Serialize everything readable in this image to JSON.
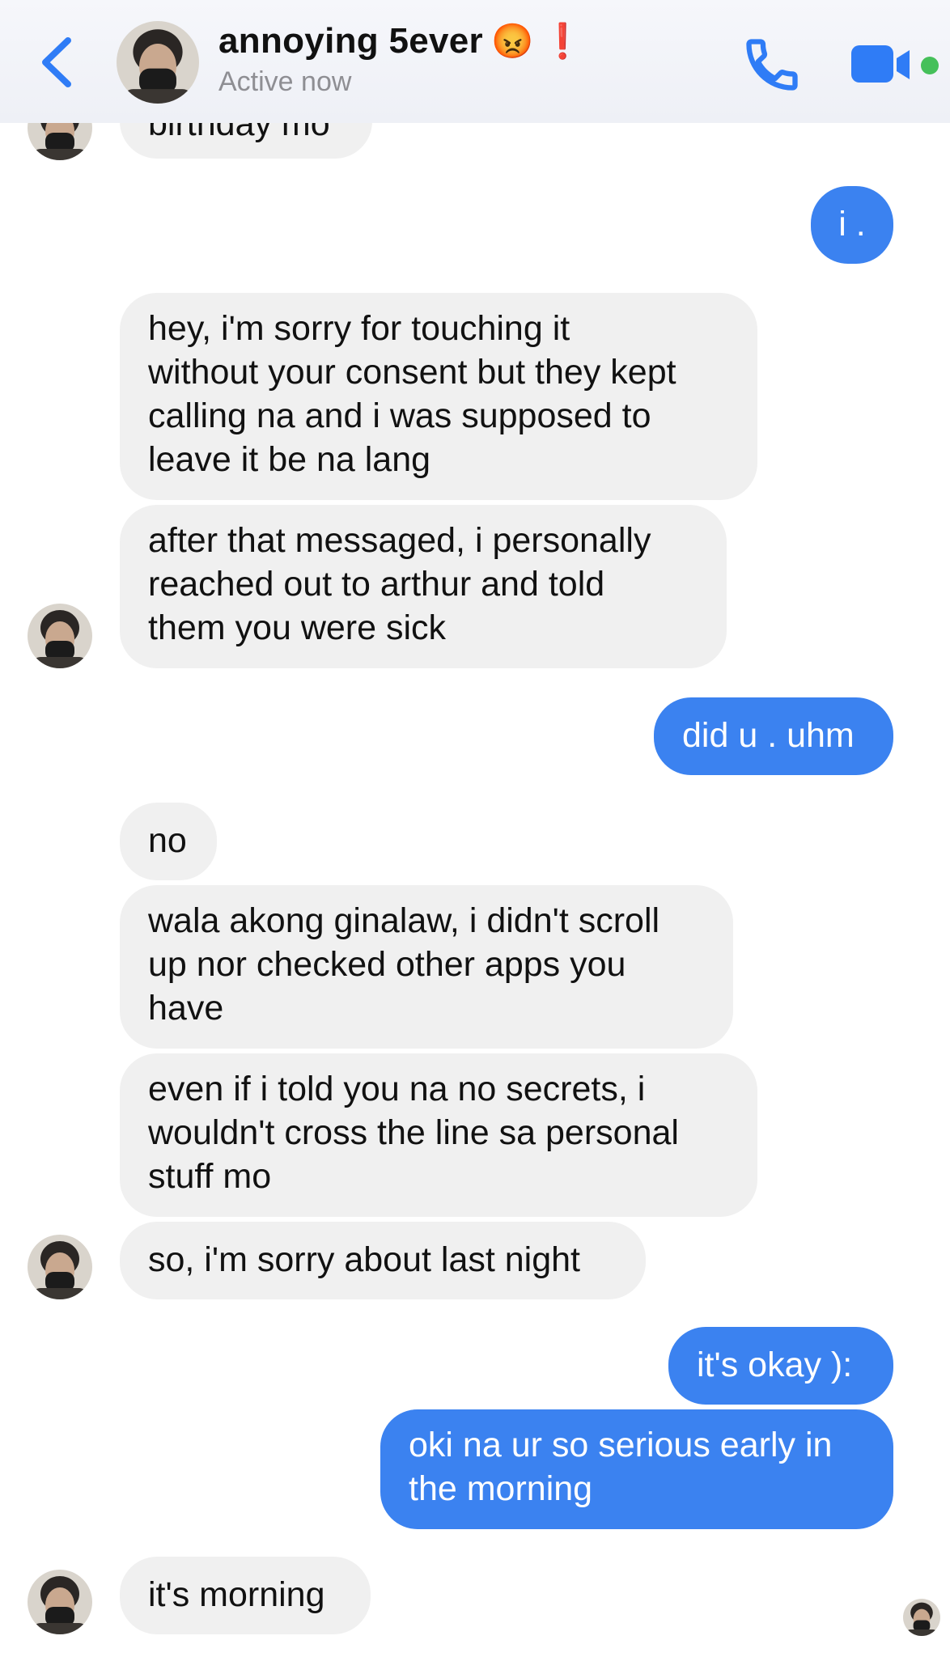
{
  "header": {
    "title": "annoying 5ever",
    "emoji_1": "😡",
    "emoji_2": "❗",
    "status": "Active now"
  },
  "messages": [
    {
      "from": "them",
      "text": "birthday mo"
    },
    {
      "from": "me",
      "text": "i ."
    },
    {
      "from": "them",
      "text": "hey, i'm sorry for touching it\nwithout your consent but they kept\ncalling na and i was supposed to\nleave it be na lang"
    },
    {
      "from": "them",
      "text": "after that messaged, i personally\nreached out to arthur and told\nthem you were sick"
    },
    {
      "from": "me",
      "text": "did u . uhm"
    },
    {
      "from": "them",
      "text": "no"
    },
    {
      "from": "them",
      "text": "wala akong ginalaw, i didn't scroll\nup nor checked other apps you\nhave"
    },
    {
      "from": "them",
      "text": "even if i told you na no secrets, i\nwouldn't cross the line sa personal\nstuff mo"
    },
    {
      "from": "them",
      "text": "so, i'm sorry about last night"
    },
    {
      "from": "me",
      "text": "it's okay ):"
    },
    {
      "from": "me",
      "text": "oki na ur so serious early in\nthe morning"
    },
    {
      "from": "them",
      "text": "it's morning"
    }
  ]
}
